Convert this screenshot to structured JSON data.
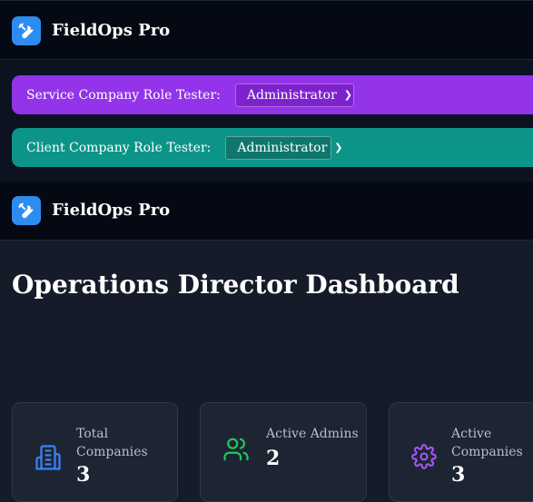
{
  "app": {
    "brand": "FieldOps Pro"
  },
  "testers": {
    "service": {
      "label": "Service Company Role Tester:",
      "selected": "Administrator"
    },
    "client": {
      "label": "Client Company Role Tester:",
      "selected": "Administrator"
    }
  },
  "page": {
    "title": "Operations Director Dashboard"
  },
  "stats": [
    {
      "label_line1": "Total",
      "label_line2": "Companies",
      "value": "3",
      "icon": "building-icon",
      "color": "#3b82f6"
    },
    {
      "label_line1": "Active Admins",
      "label_line2": "",
      "value": "2",
      "icon": "users-icon",
      "color": "#22c55e"
    },
    {
      "label_line1": "Active",
      "label_line2": "Companies",
      "value": "3",
      "icon": "gear-icon",
      "color": "#a855f7"
    }
  ],
  "colors": {
    "logo": "#2d8cf0",
    "service_bar": "#9333ea",
    "client_bar": "#0d9488"
  }
}
